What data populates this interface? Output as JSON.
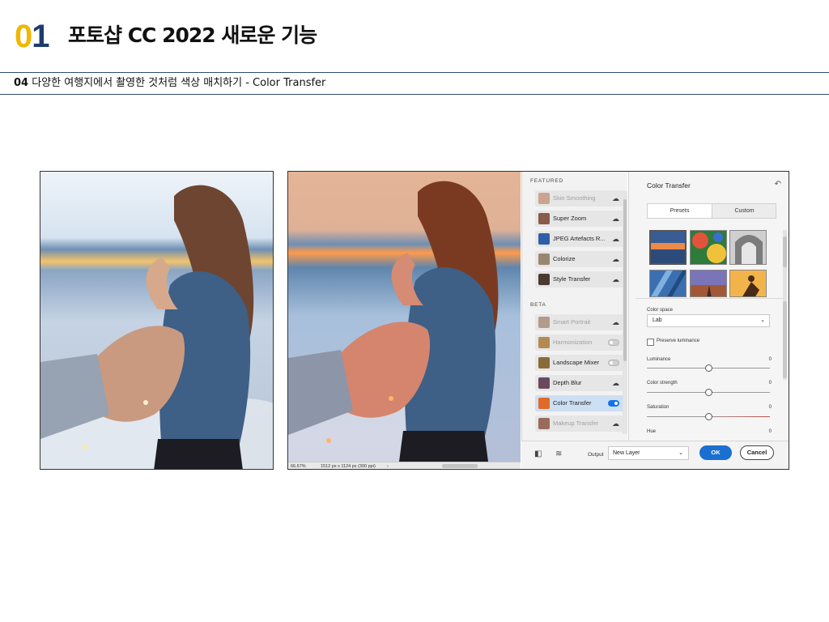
{
  "slide": {
    "number_first": "0",
    "number_second": "1",
    "title": "포토샵 CC 2022 새로운 기능",
    "subtitle_number": "04",
    "subtitle_text": " 다양한 여행지에서 촬영한 것처럼 색상 매치하기 - Color Transfer"
  },
  "status_bar": {
    "zoom": "66.67%",
    "doc_info": "1512 px x 1124 px (300 ppi)",
    "arrow": "›"
  },
  "filters_panel": {
    "featured_label": "FEATURED",
    "beta_label": "BETA",
    "featured": [
      {
        "label": "Skin Smoothing",
        "state": "disabled",
        "control": "cloud"
      },
      {
        "label": "Super Zoom",
        "state": "normal",
        "control": "cloud"
      },
      {
        "label": "JPEG Artefacts R...",
        "state": "normal",
        "control": "cloud"
      },
      {
        "label": "Colorize",
        "state": "normal",
        "control": "cloud"
      },
      {
        "label": "Style Transfer",
        "state": "normal",
        "control": "cloud"
      }
    ],
    "beta": [
      {
        "label": "Smart Portrait",
        "state": "disabled",
        "control": "cloud"
      },
      {
        "label": "Harmonization",
        "state": "disabled",
        "control": "toggle-off"
      },
      {
        "label": "Landscape Mixer",
        "state": "normal",
        "control": "toggle-off"
      },
      {
        "label": "Depth Blur",
        "state": "normal",
        "control": "cloud"
      },
      {
        "label": "Color Transfer",
        "state": "selected",
        "control": "toggle-on"
      },
      {
        "label": "Makeup Transfer",
        "state": "disabled",
        "control": "cloud"
      }
    ],
    "cloud_icon": "☁"
  },
  "properties": {
    "title": "Color Transfer",
    "reset_icon": "↶",
    "tab_presets": "Presets",
    "tab_custom": "Custom",
    "color_space_label": "Color space",
    "color_space_value": "Lab",
    "preserve_luminance": "Preserve luminance",
    "luminance_label": "Luminance",
    "luminance_value": "0",
    "color_strength_label": "Color strength",
    "color_strength_value": "0",
    "saturation_label": "Saturation",
    "saturation_value": "0",
    "hue_label": "Hue",
    "hue_value": "0",
    "chevron": "⌄"
  },
  "bottom_bar": {
    "output_label": "Output",
    "output_value": "New Layer",
    "ok_label": "OK",
    "cancel_label": "Cancel"
  }
}
